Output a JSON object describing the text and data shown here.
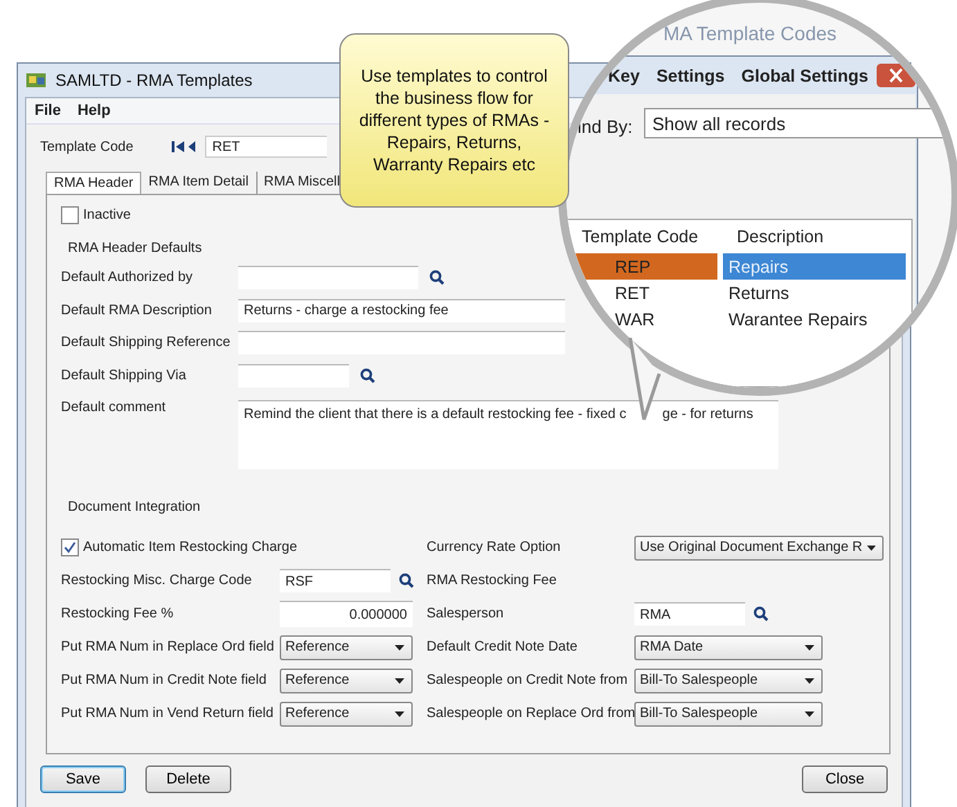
{
  "window": {
    "title": "SAMLTD - RMA Templates",
    "menu": [
      "File",
      "Help"
    ]
  },
  "template_code": {
    "label": "Template Code",
    "value": "RET"
  },
  "tabs": [
    {
      "label": "RMA Header",
      "selected": true
    },
    {
      "label": "RMA Item Detail",
      "selected": false
    },
    {
      "label": "RMA Miscell",
      "selected": false
    }
  ],
  "inactive": {
    "label": "Inactive",
    "checked": false
  },
  "header_defaults": {
    "title": "RMA Header Defaults",
    "fields": [
      {
        "label": "Default Authorized by",
        "kind": "lookup"
      },
      {
        "label": "Default RMA Description",
        "kind": "text",
        "value": "Returns - charge a restocking fee"
      },
      {
        "label": "Default Shipping Reference",
        "kind": "text"
      },
      {
        "label": "Default Shipping Via",
        "kind": "short_lookup"
      }
    ]
  },
  "comment": {
    "label": "Default comment",
    "value_before": "Remind the client that there is a default restocking fee - fixed c",
    "value_after": "ge - for returns"
  },
  "document_integration": {
    "title": "Document Integration",
    "rows": [
      {
        "left": {
          "kind": "checkbox",
          "label": "Automatic Item Restocking Charge",
          "checked": true
        },
        "right": {
          "kind": "dropdown",
          "label": "Currency Rate Option",
          "value": "Use Original Document Exchange R"
        }
      },
      {
        "left": {
          "kind": "lookup",
          "label": "Restocking Misc. Charge Code",
          "value": "RSF"
        },
        "right": {
          "kind": "note",
          "label": "RMA Restocking Fee"
        }
      },
      {
        "left": {
          "kind": "number",
          "label": "Restocking Fee %",
          "value": "0.000000"
        },
        "right": {
          "kind": "lookup",
          "label": "Salesperson",
          "value": "RMA"
        }
      },
      {
        "left": {
          "kind": "dropdown",
          "label": "Put RMA Num in Replace Ord field",
          "value": "Reference"
        },
        "right": {
          "kind": "dropdown",
          "label": "Default Credit Note Date",
          "value": "RMA Date"
        }
      },
      {
        "left": {
          "kind": "dropdown",
          "label": "Put RMA Num in Credit Note field",
          "value": "Reference"
        },
        "right": {
          "kind": "dropdown",
          "label": "Salespeople on Credit Note from",
          "value": "Bill-To Salespeople"
        }
      },
      {
        "left": {
          "kind": "dropdown",
          "label": "Put RMA Num in Vend Return field",
          "value": "Reference"
        },
        "right": {
          "kind": "dropdown",
          "label": "Salespeople on Replace Ord from",
          "value": "Bill-To Salespeople"
        }
      }
    ]
  },
  "buttons": [
    {
      "label": "Save",
      "kind": "default"
    },
    {
      "label": "Delete",
      "kind": "normal"
    }
  ],
  "close_button": {
    "label": "Close"
  },
  "callout": {
    "text": "Use templates to control the business flow for different types of RMAs - Repairs, Returns, Warranty Repairs etc"
  },
  "magnifier": {
    "title": "MA Template Codes",
    "menu": [
      "Key",
      "Settings",
      "Global Settings"
    ],
    "find_by": {
      "label": "ind By:",
      "value": "Show all records"
    },
    "list": {
      "columns": [
        "Template Code",
        "Description"
      ],
      "rows": [
        {
          "code": "REP",
          "description": "Repairs",
          "selected": true
        },
        {
          "code": "RET",
          "description": "Returns",
          "selected": false
        },
        {
          "code": "WAR",
          "description": "Warantee Repairs",
          "selected": false
        }
      ]
    }
  }
}
